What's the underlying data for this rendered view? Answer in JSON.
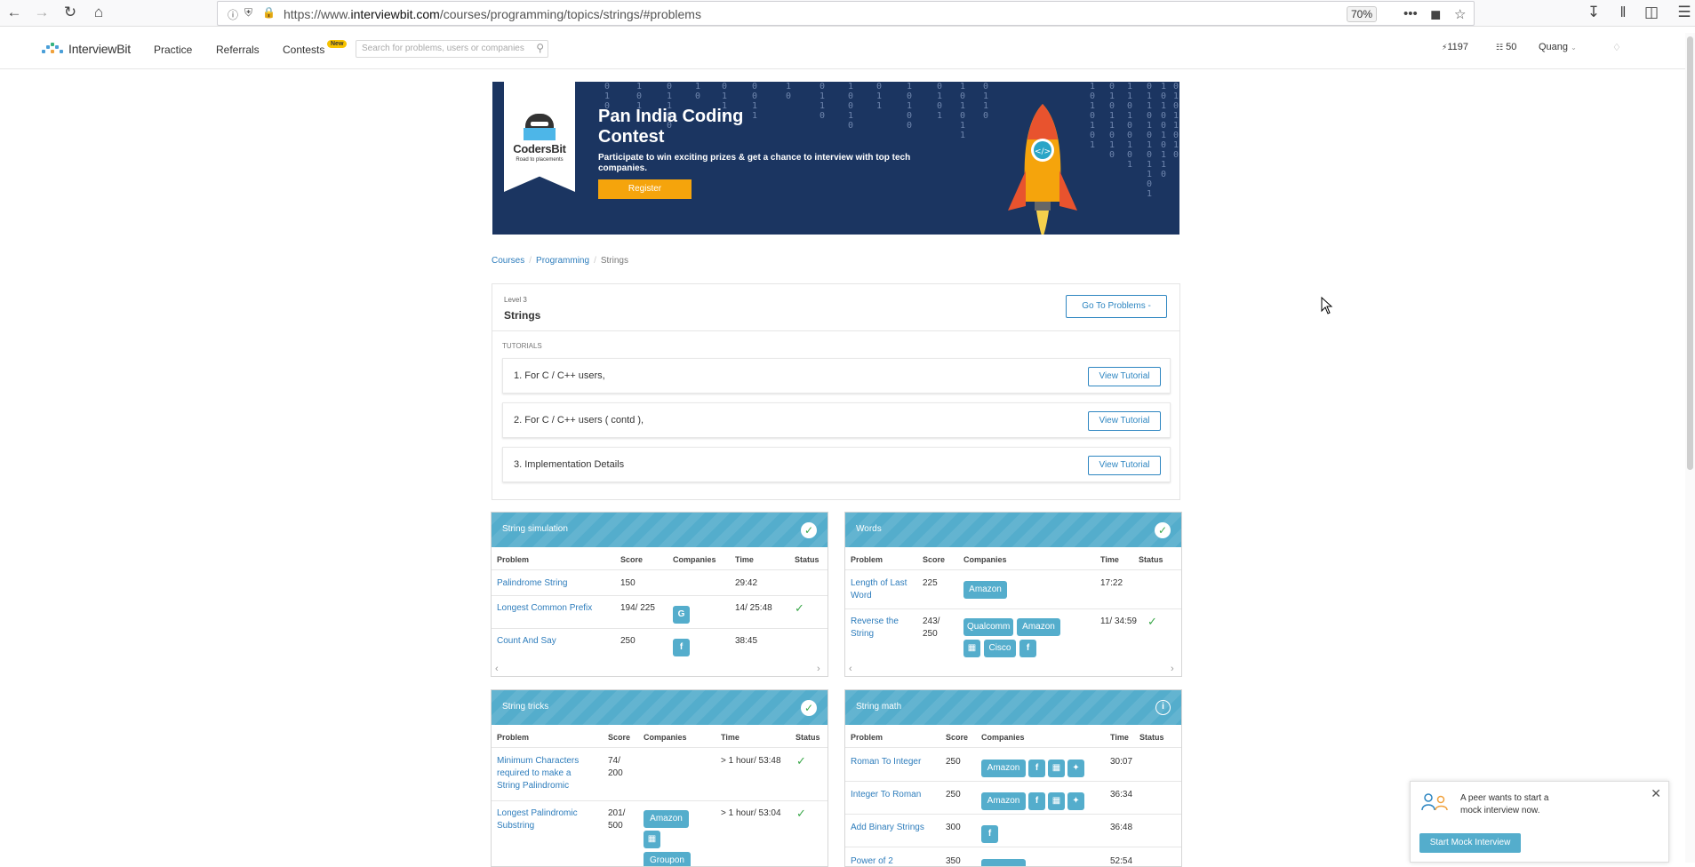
{
  "browser": {
    "url_prefix": "https://www.",
    "url_host": "interviewbit.com",
    "url_path": "/courses/programming/topics/strings/#problems",
    "zoom": "70%"
  },
  "site": {
    "brand": "InterviewBit",
    "nav": [
      "Practice",
      "Referrals",
      "Contests"
    ],
    "new_badge": "New",
    "search_placeholder": "Search for problems, users or companies",
    "score": "1197",
    "coins": "50",
    "user": "Quang"
  },
  "banner": {
    "logo_title": "CodersBit",
    "logo_sub": "Road to placements",
    "title": "Pan India Coding Contest",
    "desc": "Participate to win exciting prizes & get a chance to interview with top tech companies.",
    "button": "Register"
  },
  "breadcrumb": [
    "Courses",
    "Programming",
    "Strings"
  ],
  "topic": {
    "level": "Level 3",
    "title": "Strings",
    "goto_button": "Go To Problems -",
    "tutorials_label": "TUTORIALS",
    "tutorials": [
      {
        "name": "1. For C / C++ users,",
        "button": "View Tutorial"
      },
      {
        "name": "2. For C / C++ users ( contd ),",
        "button": "View Tutorial"
      },
      {
        "name": "3. Implementation Details",
        "button": "View Tutorial"
      }
    ]
  },
  "headers": {
    "problem": "Problem",
    "score": "Score",
    "companies": "Companies",
    "time": "Time",
    "status": "Status"
  },
  "panels": {
    "sim": {
      "title": "String simulation",
      "rows": [
        {
          "name": "Palindrome String",
          "score": "150",
          "time": "29:42"
        },
        {
          "name": "Longest Common Prefix",
          "score": "194/ 225",
          "tag": "G",
          "time": "14/ 25:48"
        },
        {
          "name": "Count And Say",
          "score": "250",
          "tag": "f",
          "time": "38:45"
        }
      ]
    },
    "words": {
      "title": "Words",
      "rows": [
        {
          "name1": "Length of Last",
          "name2": "Word",
          "score": "225",
          "tag": "Amazon",
          "time": "17:22"
        },
        {
          "name1": "Reverse the",
          "name2": "String",
          "score1": "243/",
          "score2": "250",
          "tags": [
            "Qualcomm",
            "Amazon",
            "Cisco",
            "f"
          ],
          "time": "11/ 34:59"
        }
      ]
    },
    "tricks": {
      "title": "String tricks",
      "rows": [
        {
          "name1": "Minimum Characters",
          "name2": "required to make a",
          "name3": "String Palindromic",
          "score1": "74/",
          "score2": "200",
          "time": "> 1 hour/ 53:48"
        },
        {
          "name1": "Longest Palindromic",
          "name2": "Substring",
          "score1": "201/",
          "score2": "500",
          "tags": [
            "Amazon",
            "Groupon"
          ],
          "time": "> 1 hour/ 53:04"
        }
      ]
    },
    "math": {
      "title": "String math",
      "rows": [
        {
          "name": "Roman To Integer",
          "score": "250",
          "tag": "Amazon",
          "time": "30:07"
        },
        {
          "name": "Integer To Roman",
          "score": "250",
          "tag": "Amazon",
          "time": "36:34"
        },
        {
          "name": "Add Binary Strings",
          "score": "300",
          "tag": "f",
          "time": "36:48"
        },
        {
          "name": "Power of 2",
          "score": "350",
          "time": "52:54"
        }
      ]
    }
  },
  "peer": {
    "message": "A peer wants to start a mock interview now.",
    "button": "Start Mock Interview"
  },
  "colors": {
    "accent": "#54adcc",
    "banner": "#1b3561",
    "link": "#2e7dbc",
    "register": "#f5a40c",
    "check": "#3ba84a"
  }
}
